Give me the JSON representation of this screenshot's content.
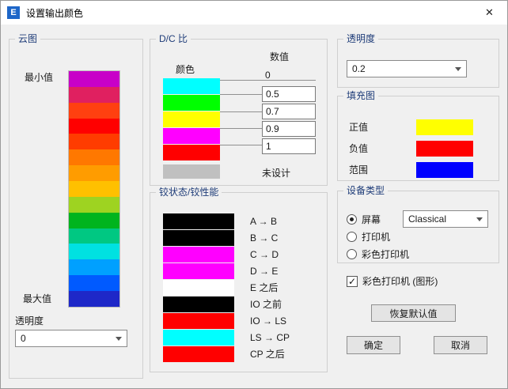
{
  "window": {
    "title": "设置输出颜色",
    "icon_letter": "E",
    "close_glyph": "✕"
  },
  "contour": {
    "group_title": "云图",
    "min_label": "最小值",
    "max_label": "最大值",
    "opacity_label": "透明度",
    "opacity_value": "0",
    "colors": [
      "#C800C8",
      "#E02060",
      "#FF4010",
      "#FF0000",
      "#FF3C00",
      "#FF7800",
      "#FF9C00",
      "#FFC000",
      "#9ED321",
      "#00B41E",
      "#00C882",
      "#00E1E1",
      "#00A0FF",
      "#005AFF",
      "#1E28C8"
    ]
  },
  "dc_ratio": {
    "group_title": "D/C 比",
    "color_header": "颜色",
    "value_header": "数值",
    "colors": [
      "#00FFFF",
      "#00FF00",
      "#FFFF00",
      "#FF00FF",
      "#FF0000"
    ],
    "values": [
      "0",
      "0.5",
      "0.7",
      "0.9",
      "1"
    ],
    "undesigned_color": "#C0C0C0",
    "undesigned_label": "未设计"
  },
  "hinge": {
    "group_title": "铰状态/铰性能",
    "rows": [
      {
        "label": "A → B",
        "color": "#000000"
      },
      {
        "label": "B → C",
        "color": "#000000"
      },
      {
        "label": "C → D",
        "color": "#FF00FF"
      },
      {
        "label": "D → E",
        "color": "#FF00FF"
      },
      {
        "label": "E 之后",
        "color": "#FFFFFF"
      },
      {
        "label": "IO 之前",
        "color": "#000000"
      },
      {
        "label": "IO → LS",
        "color": "#FF0000"
      },
      {
        "label": "LS → CP",
        "color": "#00FFFF"
      },
      {
        "label": "CP 之后",
        "color": "#FF0000"
      }
    ]
  },
  "opacity_box": {
    "group_title": "透明度",
    "value": "0.2"
  },
  "fill": {
    "group_title": "填充图",
    "rows": [
      {
        "label": "正值",
        "color": "#FFFF00"
      },
      {
        "label": "负值",
        "color": "#FF0000"
      },
      {
        "label": "范围",
        "color": "#0000FF"
      }
    ]
  },
  "device": {
    "group_title": "设备类型",
    "options": [
      {
        "label": "屏幕",
        "selected": true
      },
      {
        "label": "打印机",
        "selected": false
      },
      {
        "label": "彩色打印机",
        "selected": false
      }
    ],
    "screen_style_value": "Classical"
  },
  "color_printer_checkbox": {
    "label": "彩色打印机 (图形)",
    "checked": true
  },
  "buttons": {
    "restore_defaults": "恢复默认值",
    "ok": "确定",
    "cancel": "取消"
  }
}
